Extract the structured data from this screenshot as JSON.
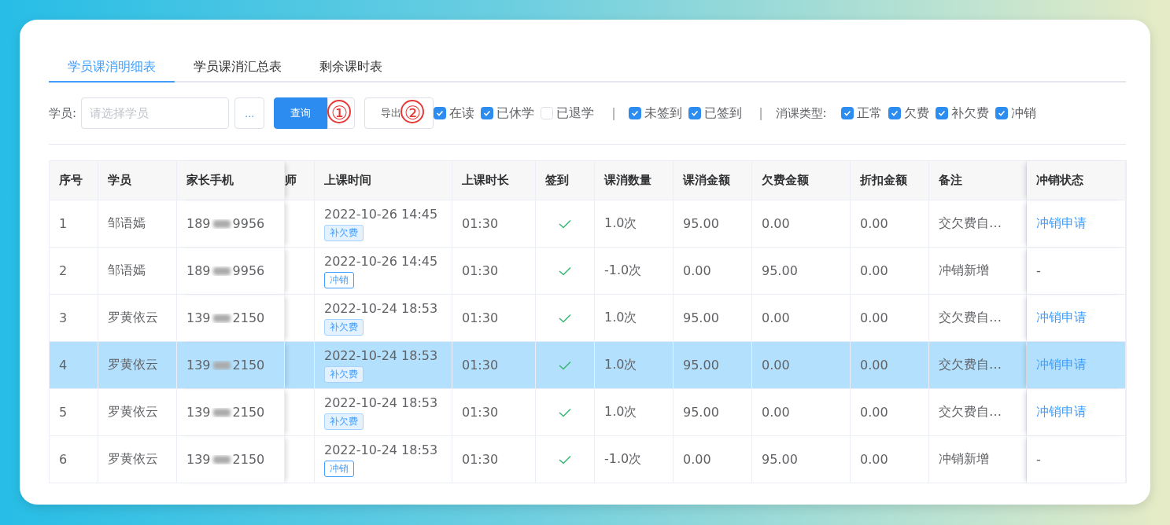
{
  "tabs": [
    {
      "label": "学员课消明细表",
      "selected": true
    },
    {
      "label": "学员课消汇总表",
      "selected": false
    },
    {
      "label": "剩余课时表",
      "selected": false
    }
  ],
  "filters": {
    "student_label": "学员:",
    "student_placeholder": "请选择学员",
    "picker_button": "...",
    "query_button": "查询",
    "export_button": "导出",
    "annotations": [
      "①",
      "②"
    ],
    "groups": [
      {
        "options": [
          {
            "label": "在读",
            "checked": true
          },
          {
            "label": "已休学",
            "checked": true
          },
          {
            "label": "已退学",
            "checked": false
          }
        ]
      },
      {
        "separator": "|",
        "options": [
          {
            "label": "未签到",
            "checked": true
          },
          {
            "label": "已签到",
            "checked": true
          }
        ]
      },
      {
        "separator": "|",
        "label": "消课类型:",
        "options": [
          {
            "label": "正常",
            "checked": true
          },
          {
            "label": "欠费",
            "checked": true
          },
          {
            "label": "补欠费",
            "checked": true
          },
          {
            "label": "冲销",
            "checked": true
          }
        ]
      }
    ]
  },
  "table": {
    "columns": [
      "序号",
      "学员",
      "家长手机",
      "师",
      "上课时间",
      "上课时长",
      "签到",
      "课消数量",
      "课消金额",
      "欠费金额",
      "折扣金额",
      "备注",
      "冲销状态"
    ],
    "rows": [
      {
        "selected": false,
        "index": "1",
        "student": "邹语嫣",
        "phone_start": "189",
        "phone_end": "9956",
        "time": "2022-10-26 14:45",
        "tag": {
          "label": "补欠费",
          "kind": "filled"
        },
        "duration": "01:30",
        "signed": true,
        "count": "1.0次",
        "amount": "95.00",
        "owed": "0.00",
        "discount": "0.00",
        "note": "交欠费自…",
        "status": {
          "kind": "link",
          "text": "冲销申请"
        }
      },
      {
        "selected": false,
        "index": "2",
        "student": "邹语嫣",
        "phone_start": "189",
        "phone_end": "9956",
        "time": "2022-10-26 14:45",
        "tag": {
          "label": "冲销",
          "kind": "outline"
        },
        "duration": "01:30",
        "signed": true,
        "count": "-1.0次",
        "amount": "0.00",
        "owed": "95.00",
        "discount": "0.00",
        "note": "冲销新增",
        "status": {
          "kind": "plain",
          "text": "-"
        }
      },
      {
        "selected": false,
        "index": "3",
        "student": "罗黄依云",
        "phone_start": "139",
        "phone_end": "2150",
        "time": "2022-10-24 18:53",
        "tag": {
          "label": "补欠费",
          "kind": "filled"
        },
        "duration": "01:30",
        "signed": true,
        "count": "1.0次",
        "amount": "95.00",
        "owed": "0.00",
        "discount": "0.00",
        "note": "交欠费自…",
        "status": {
          "kind": "link",
          "text": "冲销申请"
        }
      },
      {
        "selected": true,
        "index": "4",
        "student": "罗黄依云",
        "phone_start": "139",
        "phone_end": "2150",
        "time": "2022-10-24 18:53",
        "tag": {
          "label": "补欠费",
          "kind": "filled"
        },
        "duration": "01:30",
        "signed": true,
        "count": "1.0次",
        "amount": "95.00",
        "owed": "0.00",
        "discount": "0.00",
        "note": "交欠费自…",
        "status": {
          "kind": "link",
          "text": "冲销申请"
        }
      },
      {
        "selected": false,
        "index": "5",
        "student": "罗黄依云",
        "phone_start": "139",
        "phone_end": "2150",
        "time": "2022-10-24 18:53",
        "tag": {
          "label": "补欠费",
          "kind": "filled"
        },
        "duration": "01:30",
        "signed": true,
        "count": "1.0次",
        "amount": "95.00",
        "owed": "0.00",
        "discount": "0.00",
        "note": "交欠费自…",
        "status": {
          "kind": "link",
          "text": "冲销申请"
        }
      },
      {
        "selected": false,
        "index": "6",
        "student": "罗黄依云",
        "phone_start": "139",
        "phone_end": "2150",
        "time": "2022-10-24 18:53",
        "tag": {
          "label": "冲销",
          "kind": "outline"
        },
        "duration": "01:30",
        "signed": true,
        "count": "-1.0次",
        "amount": "0.00",
        "owed": "95.00",
        "discount": "0.00",
        "note": "冲销新增",
        "status": {
          "kind": "plain",
          "text": "-"
        }
      }
    ]
  }
}
